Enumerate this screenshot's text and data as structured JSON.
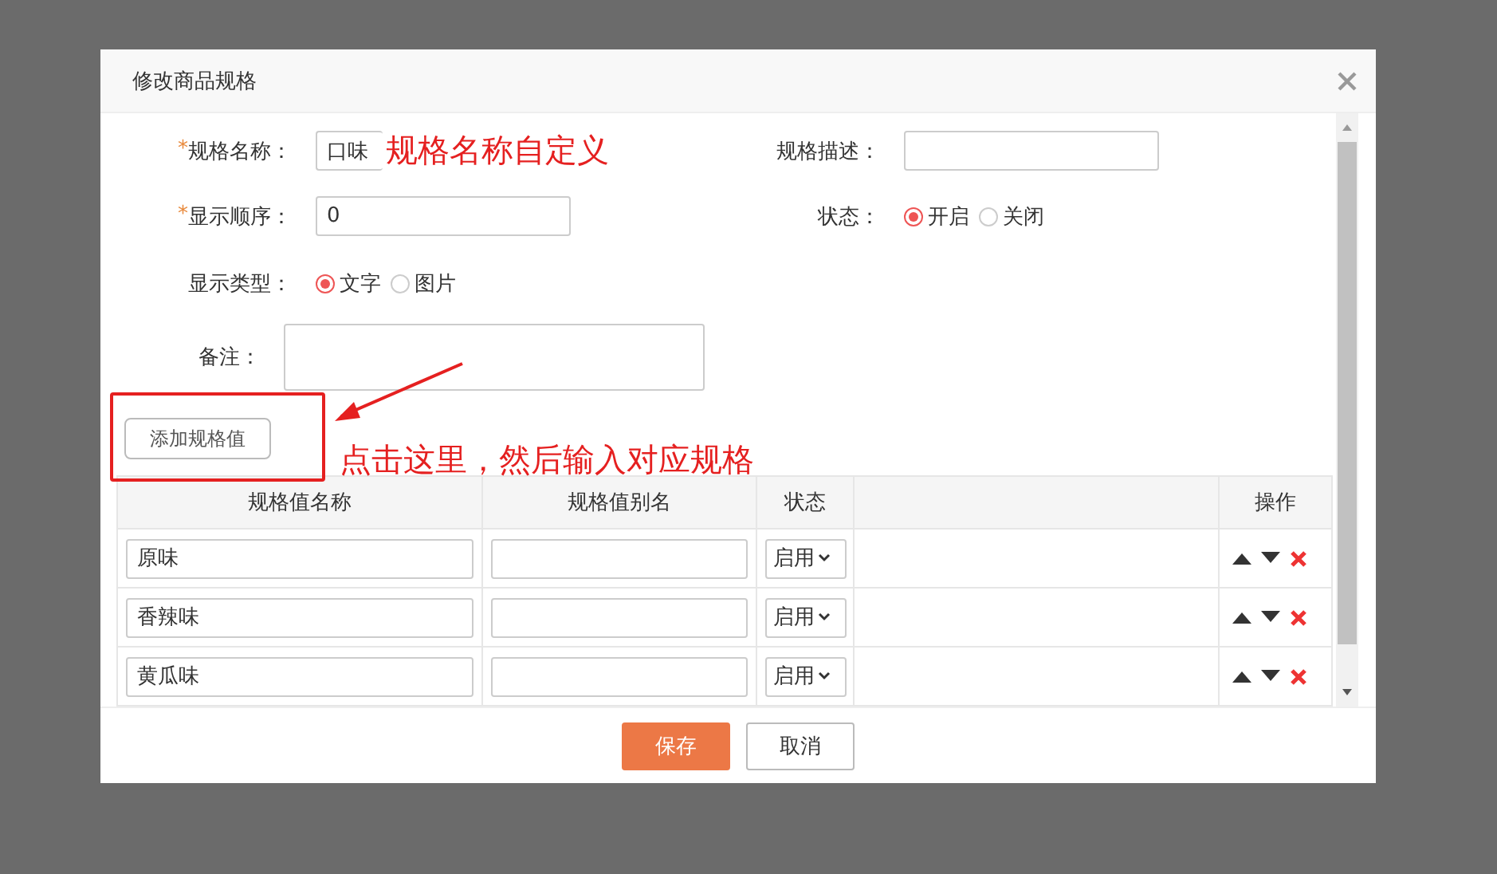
{
  "dialog": {
    "title": "修改商品规格"
  },
  "form": {
    "name": {
      "label": "规格名称：",
      "required_mark": "*",
      "value": "口味"
    },
    "description": {
      "label": "规格描述："
    },
    "order": {
      "label": "显示顺序：",
      "required_mark": "*",
      "value": "0"
    },
    "status": {
      "label": "状态：",
      "options": [
        {
          "label": "开启",
          "selected": true
        },
        {
          "label": "关闭",
          "selected": false
        }
      ]
    },
    "display_type": {
      "label": "显示类型：",
      "options": [
        {
          "label": "文字",
          "selected": true
        },
        {
          "label": "图片",
          "selected": false
        }
      ]
    },
    "remark": {
      "label": "备注："
    }
  },
  "add_button": "添加规格值",
  "table": {
    "columns": [
      "规格值名称",
      "规格值别名",
      "状态",
      "操作"
    ],
    "rows": [
      {
        "name": "原味",
        "status": "启用"
      },
      {
        "name": "香辣味",
        "status": "启用"
      },
      {
        "name": "黄瓜味",
        "status": "启用"
      }
    ]
  },
  "buttons": [
    {
      "label": "保存",
      "kind": "primary"
    },
    {
      "label": "取消",
      "kind": "default"
    }
  ],
  "annotations": [
    {
      "text": "规格名称自定义"
    },
    {
      "text": "点击这里，然后输入对应规格"
    }
  ]
}
